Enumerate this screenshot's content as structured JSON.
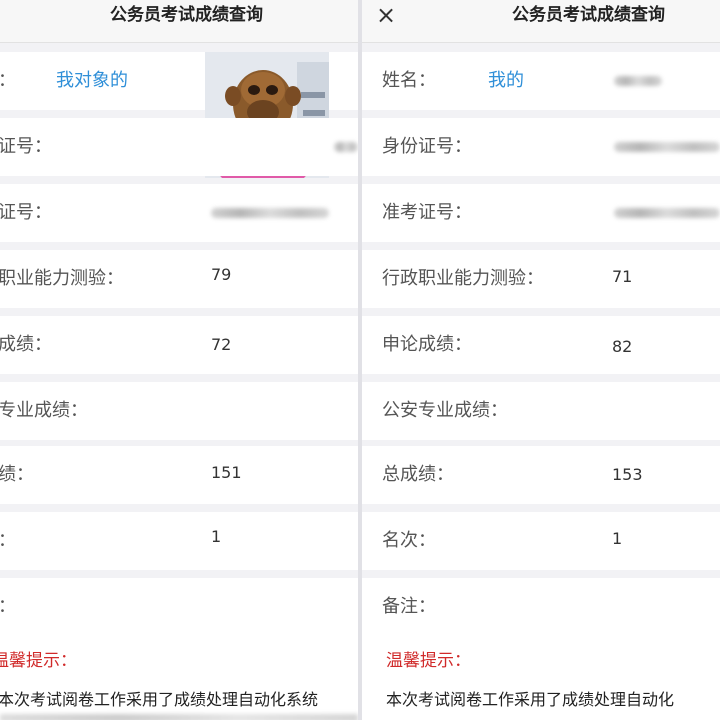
{
  "left_panel": {
    "title": "公务员考试成绩查询",
    "fields": {
      "name_label": "名：",
      "name_value": "我对象的",
      "id_label": "份证号：",
      "ticket_label": "考证号：",
      "xingce_label": "政职业能力测验：",
      "xingce_value": "79",
      "shenlun_label": "论成绩：",
      "shenlun_value": "72",
      "gongan_label": "安专业成绩：",
      "total_label": "成绩：",
      "total_value": "151",
      "rank_label": "次：",
      "rank_value": "1",
      "remark_label": "注："
    },
    "notice": {
      "heading": "温馨提示：",
      "text": "本次考试阅卷工作采用了成绩处理自动化系统"
    }
  },
  "right_panel": {
    "title": "公务员考试成绩查询",
    "close_icon": "×",
    "fields": {
      "name_label": "姓名：",
      "name_value": "我的",
      "id_label": "身份证号：",
      "ticket_label": "准考证号：",
      "xingce_label": "行政职业能力测验：",
      "xingce_value": "71",
      "shenlun_label": "申论成绩：",
      "shenlun_value": "82",
      "gongan_label": "公安专业成绩：",
      "total_label": "总成绩：",
      "total_value": "153",
      "rank_label": "名次：",
      "rank_value": "1",
      "remark_label": "备注："
    },
    "notice": {
      "heading": "温馨提示：",
      "text": "本次考试阅卷工作采用了成绩处理自动化"
    }
  },
  "icons": {
    "close": "close-icon",
    "photo": "monkey-photo"
  },
  "colors": {
    "name_link": "#2f8fd8",
    "notice_heading": "#d02a2a",
    "row_bg": "#ffffff",
    "page_bg": "#f2f2f5"
  }
}
